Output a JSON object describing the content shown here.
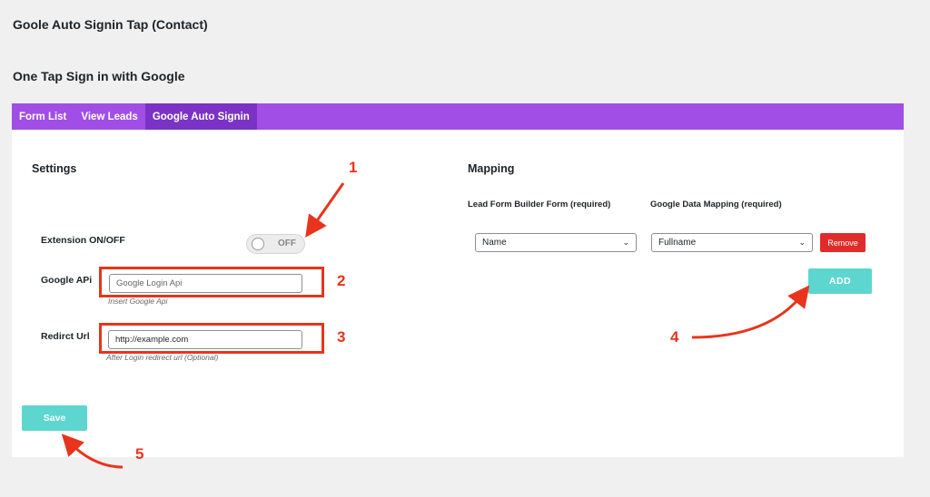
{
  "page": {
    "title": "Goole Auto Signin Tap (Contact)",
    "section_title": "One Tap Sign in with Google"
  },
  "tabs": [
    {
      "label": "Form List",
      "active": false
    },
    {
      "label": "View Leads",
      "active": false
    },
    {
      "label": "Google Auto Signin",
      "active": true
    }
  ],
  "settings": {
    "heading": "Settings",
    "extension_label": "Extension ON/OFF",
    "toggle_state": "OFF",
    "google_api_label": "Google APi",
    "google_api_placeholder": "Google Login Api",
    "google_api_hint": "Insert Google Api",
    "redirect_label": "Redirct Url",
    "redirect_value": "http://example.com",
    "redirect_hint": "After Login redirect url (Optional)",
    "save_label": "Save"
  },
  "mapping": {
    "heading": "Mapping",
    "col1_header": "Lead Form Builder Form (required)",
    "col2_header": "Google Data Mapping (required)",
    "row": {
      "form_field": "Name",
      "google_field": "Fullname",
      "remove_label": "Remove"
    },
    "add_label": "ADD"
  },
  "annotations": [
    "1",
    "2",
    "3",
    "4",
    "5"
  ],
  "colors": {
    "tab_bar": "#a04ee6",
    "tab_active": "#7a33c4",
    "button_teal": "#5dd6cf",
    "remove_red": "#e02b2b",
    "annotation_red": "#e8341c"
  }
}
